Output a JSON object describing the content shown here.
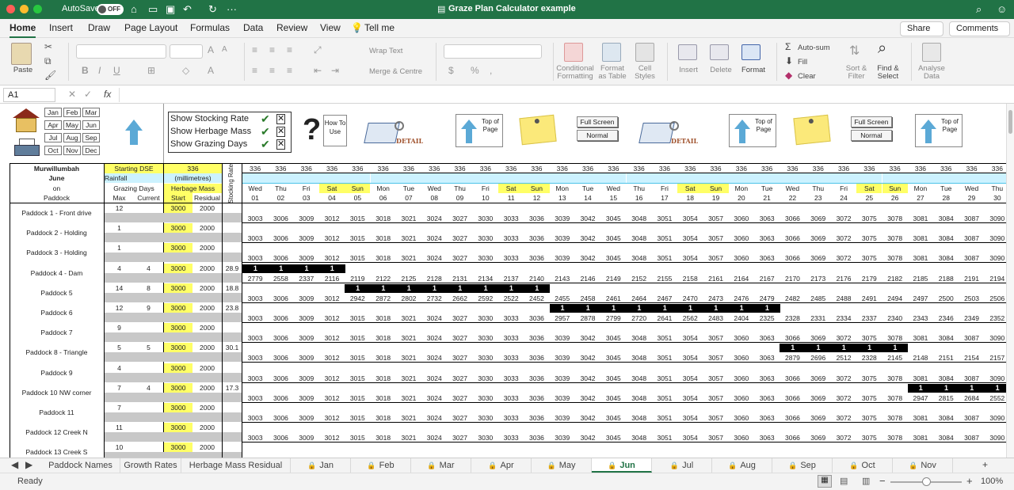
{
  "window": {
    "autosave_label": "AutoSave",
    "autosave_state": "OFF",
    "title": "Graze Plan Calculator example"
  },
  "menu": {
    "tabs": [
      "Home",
      "Insert",
      "Draw",
      "Page Layout",
      "Formulas",
      "Data",
      "Review",
      "View"
    ],
    "tell_me": "Tell me",
    "share": "Share",
    "comments": "Comments"
  },
  "ribbon": {
    "paste": "Paste",
    "wrap_text": "Wrap Text",
    "merge_centre": "Merge & Centre",
    "conditional_formatting": "Conditional Formatting",
    "format_as_table": "Format as Table",
    "cell_styles": "Cell Styles",
    "insert": "Insert",
    "delete": "Delete",
    "format": "Format",
    "auto_sum": "Auto-sum",
    "fill": "Fill",
    "clear": "Clear",
    "sort_filter": "Sort & Filter",
    "find_select": "Find & Select",
    "analyse_data": "Analyse Data"
  },
  "formula_bar": {
    "cell_ref": "A1",
    "fx": "fx",
    "value": ""
  },
  "sheet": {
    "months": [
      "Jan",
      "Feb",
      "Mar",
      "Apr",
      "May",
      "Jun",
      "Jul",
      "Aug",
      "Sep",
      "Oct",
      "Nov",
      "Dec"
    ],
    "show_options": [
      "Show Stocking Rate",
      "Show Herbage Mass",
      "Show Grazing Days"
    ],
    "how_to_use": "How To Use",
    "detail": "DETAIL",
    "top_of_page": "Top of Page",
    "full_screen": "Full Screen",
    "normal": "Normal",
    "farm": "Murwillumbah",
    "month": "June",
    "on": "on",
    "paddock_header": "Paddock",
    "starting_dse_label": "Starting DSE",
    "starting_dse": "336",
    "rainfall_label": "Rainfall",
    "rainfall_unit": "(millimetres)",
    "grazing_days_label": "Grazing Days",
    "max_label": "Max",
    "current_label": "Current",
    "herbage_mass_label": "Herbage Mass",
    "start_label": "Start",
    "residual_label": "Residual",
    "stocking_rate_label": "Stocking Rate",
    "dse_per_day": "336",
    "weekdays": [
      "Wed",
      "Thu",
      "Fri",
      "Sat",
      "Sun",
      "Mon",
      "Tue",
      "Wed",
      "Thu",
      "Fri",
      "Sat",
      "Sun",
      "Mon",
      "Tue",
      "Wed",
      "Thu",
      "Fri",
      "Sat",
      "Sun",
      "Mon",
      "Tue",
      "Wed",
      "Thu",
      "Fri",
      "Sat",
      "Sun",
      "Mon",
      "Tue",
      "Wed",
      "Thu"
    ],
    "dates": [
      "01",
      "02",
      "03",
      "04",
      "05",
      "06",
      "07",
      "08",
      "09",
      "10",
      "11",
      "12",
      "13",
      "14",
      "15",
      "16",
      "17",
      "18",
      "19",
      "20",
      "21",
      "22",
      "23",
      "24",
      "25",
      "26",
      "27",
      "28",
      "29",
      "30"
    ],
    "weekend_idx": [
      3,
      4,
      10,
      11,
      17,
      18,
      24,
      25
    ],
    "paddocks": [
      {
        "name": "Paddock 1 - Front drive",
        "max": "12",
        "current": "",
        "start": "3000",
        "residual": "2000",
        "rate": "",
        "graze": [],
        "mass": [
          "3003",
          "3006",
          "3009",
          "3012",
          "3015",
          "3018",
          "3021",
          "3024",
          "3027",
          "3030",
          "3033",
          "3036",
          "3039",
          "3042",
          "3045",
          "3048",
          "3051",
          "3054",
          "3057",
          "3060",
          "3063",
          "3066",
          "3069",
          "3072",
          "3075",
          "3078",
          "3081",
          "3084",
          "3087",
          "3090"
        ]
      },
      {
        "name": "Paddock 2 - Holding",
        "max": "1",
        "current": "",
        "start": "3000",
        "residual": "2000",
        "rate": "",
        "graze": [],
        "mass": [
          "3003",
          "3006",
          "3009",
          "3012",
          "3015",
          "3018",
          "3021",
          "3024",
          "3027",
          "3030",
          "3033",
          "3036",
          "3039",
          "3042",
          "3045",
          "3048",
          "3051",
          "3054",
          "3057",
          "3060",
          "3063",
          "3066",
          "3069",
          "3072",
          "3075",
          "3078",
          "3081",
          "3084",
          "3087",
          "3090"
        ]
      },
      {
        "name": "Paddock 3 - Holding",
        "max": "1",
        "current": "",
        "start": "3000",
        "residual": "2000",
        "rate": "",
        "graze": [],
        "mass": [
          "3003",
          "3006",
          "3009",
          "3012",
          "3015",
          "3018",
          "3021",
          "3024",
          "3027",
          "3030",
          "3033",
          "3036",
          "3039",
          "3042",
          "3045",
          "3048",
          "3051",
          "3054",
          "3057",
          "3060",
          "3063",
          "3066",
          "3069",
          "3072",
          "3075",
          "3078",
          "3081",
          "3084",
          "3087",
          "3090"
        ]
      },
      {
        "name": "Paddock 4 - Dam",
        "max": "4",
        "current": "4",
        "start": "3000",
        "residual": "2000",
        "rate": "28.9",
        "graze": [
          0,
          1,
          2,
          3
        ],
        "mass": [
          "2779",
          "2558",
          "2337",
          "2116",
          "2119",
          "2122",
          "2125",
          "2128",
          "2131",
          "2134",
          "2137",
          "2140",
          "2143",
          "2146",
          "2149",
          "2152",
          "2155",
          "2158",
          "2161",
          "2164",
          "2167",
          "2170",
          "2173",
          "2176",
          "2179",
          "2182",
          "2185",
          "2188",
          "2191",
          "2194"
        ]
      },
      {
        "name": "Paddock 5",
        "max": "14",
        "current": "8",
        "start": "3000",
        "residual": "2000",
        "rate": "18.8",
        "graze": [
          4,
          5,
          6,
          7,
          8,
          9,
          10,
          11
        ],
        "mass": [
          "3003",
          "3006",
          "3009",
          "3012",
          "2942",
          "2872",
          "2802",
          "2732",
          "2662",
          "2592",
          "2522",
          "2452",
          "2455",
          "2458",
          "2461",
          "2464",
          "2467",
          "2470",
          "2473",
          "2476",
          "2479",
          "2482",
          "2485",
          "2488",
          "2491",
          "2494",
          "2497",
          "2500",
          "2503",
          "2506"
        ]
      },
      {
        "name": "Paddock 6",
        "max": "12",
        "current": "9",
        "start": "3000",
        "residual": "2000",
        "rate": "23.8",
        "graze": [
          12,
          13,
          14,
          15,
          16,
          17,
          18,
          19,
          20
        ],
        "mass": [
          "3003",
          "3006",
          "3009",
          "3012",
          "3015",
          "3018",
          "3021",
          "3024",
          "3027",
          "3030",
          "3033",
          "3036",
          "2957",
          "2878",
          "2799",
          "2720",
          "2641",
          "2562",
          "2483",
          "2404",
          "2325",
          "2328",
          "2331",
          "2334",
          "2337",
          "2340",
          "2343",
          "2346",
          "2349",
          "2352"
        ]
      },
      {
        "name": "Paddock 7",
        "max": "9",
        "current": "",
        "start": "3000",
        "residual": "2000",
        "rate": "",
        "graze": [],
        "mass": [
          "3003",
          "3006",
          "3009",
          "3012",
          "3015",
          "3018",
          "3021",
          "3024",
          "3027",
          "3030",
          "3033",
          "3036",
          "3039",
          "3042",
          "3045",
          "3048",
          "3051",
          "3054",
          "3057",
          "3060",
          "3063",
          "3066",
          "3069",
          "3072",
          "3075",
          "3078",
          "3081",
          "3084",
          "3087",
          "3090"
        ]
      },
      {
        "name": "Paddock 8 - Triangle",
        "max": "5",
        "current": "5",
        "start": "3000",
        "residual": "2000",
        "rate": "30.1",
        "graze": [
          21,
          22,
          23,
          24,
          25
        ],
        "mass": [
          "3003",
          "3006",
          "3009",
          "3012",
          "3015",
          "3018",
          "3021",
          "3024",
          "3027",
          "3030",
          "3033",
          "3036",
          "3039",
          "3042",
          "3045",
          "3048",
          "3051",
          "3054",
          "3057",
          "3060",
          "3063",
          "2879",
          "2696",
          "2512",
          "2328",
          "2145",
          "2148",
          "2151",
          "2154",
          "2157"
        ]
      },
      {
        "name": "Paddock 9",
        "max": "4",
        "current": "",
        "start": "3000",
        "residual": "2000",
        "rate": "",
        "graze": [],
        "mass": [
          "3003",
          "3006",
          "3009",
          "3012",
          "3015",
          "3018",
          "3021",
          "3024",
          "3027",
          "3030",
          "3033",
          "3036",
          "3039",
          "3042",
          "3045",
          "3048",
          "3051",
          "3054",
          "3057",
          "3060",
          "3063",
          "3066",
          "3069",
          "3072",
          "3075",
          "3078",
          "3081",
          "3084",
          "3087",
          "3090"
        ]
      },
      {
        "name": "Paddock 10 NW corner",
        "max": "7",
        "current": "4",
        "start": "3000",
        "residual": "2000",
        "rate": "17.3",
        "graze": [
          26,
          27,
          28,
          29
        ],
        "mass": [
          "3003",
          "3006",
          "3009",
          "3012",
          "3015",
          "3018",
          "3021",
          "3024",
          "3027",
          "3030",
          "3033",
          "3036",
          "3039",
          "3042",
          "3045",
          "3048",
          "3051",
          "3054",
          "3057",
          "3060",
          "3063",
          "3066",
          "3069",
          "3072",
          "3075",
          "3078",
          "2947",
          "2815",
          "2684",
          "2552"
        ]
      },
      {
        "name": "Paddock 11",
        "max": "7",
        "current": "",
        "start": "3000",
        "residual": "2000",
        "rate": "",
        "graze": [],
        "mass": [
          "3003",
          "3006",
          "3009",
          "3012",
          "3015",
          "3018",
          "3021",
          "3024",
          "3027",
          "3030",
          "3033",
          "3036",
          "3039",
          "3042",
          "3045",
          "3048",
          "3051",
          "3054",
          "3057",
          "3060",
          "3063",
          "3066",
          "3069",
          "3072",
          "3075",
          "3078",
          "3081",
          "3084",
          "3087",
          "3090"
        ]
      },
      {
        "name": "Paddock 12 Creek N",
        "max": "11",
        "current": "",
        "start": "3000",
        "residual": "2000",
        "rate": "",
        "graze": [],
        "mass": [
          "3003",
          "3006",
          "3009",
          "3012",
          "3015",
          "3018",
          "3021",
          "3024",
          "3027",
          "3030",
          "3033",
          "3036",
          "3039",
          "3042",
          "3045",
          "3048",
          "3051",
          "3054",
          "3057",
          "3060",
          "3063",
          "3066",
          "3069",
          "3072",
          "3075",
          "3078",
          "3081",
          "3084",
          "3087",
          "3090"
        ]
      },
      {
        "name": "Paddock 13 Creek S",
        "max": "10",
        "current": "",
        "start": "3000",
        "residual": "2000",
        "rate": "",
        "graze": [],
        "mass": []
      }
    ]
  },
  "sheet_tabs": [
    "Paddock Names",
    "Growth Rates",
    "Herbage Mass Residual",
    "Jan",
    "Feb",
    "Mar",
    "Apr",
    "May",
    "Jun",
    "Jul",
    "Aug",
    "Sep",
    "Oct",
    "Nov"
  ],
  "active_tab": "Jun",
  "status": {
    "ready": "Ready",
    "zoom": "100%"
  }
}
